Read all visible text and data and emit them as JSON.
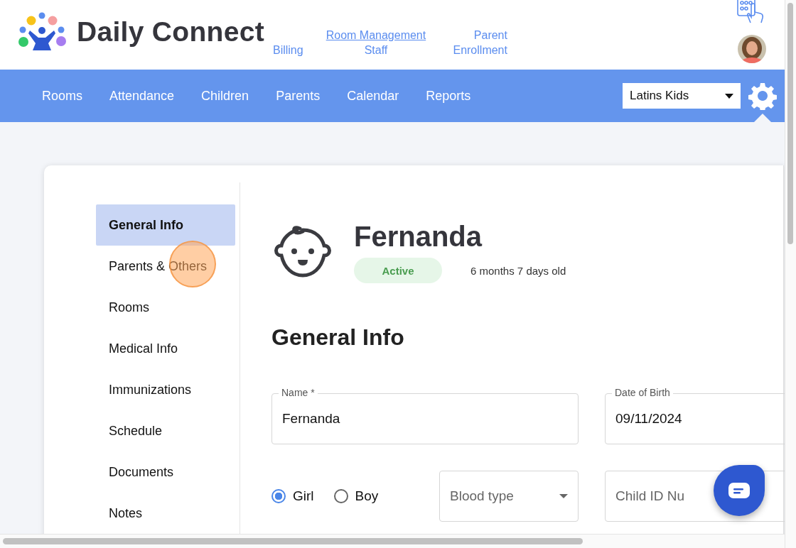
{
  "brand": {
    "name": "Daily Connect"
  },
  "header_links": [
    {
      "lines": [
        {
          "text": "Billing",
          "underlined": false
        }
      ]
    },
    {
      "lines": [
        {
          "text": "Room Management",
          "underlined": true
        },
        {
          "text": "Staff",
          "underlined": false
        }
      ]
    },
    {
      "lines": [
        {
          "text": "Parent",
          "underlined": false
        },
        {
          "text": "Enrollment",
          "underlined": false
        }
      ]
    }
  ],
  "nav": {
    "items": [
      "Rooms",
      "Attendance",
      "Children",
      "Parents",
      "Calendar",
      "Reports"
    ],
    "school_select": {
      "value": "Latins Kids"
    }
  },
  "sidebar": {
    "items": [
      {
        "label": "General Info",
        "selected": true
      },
      {
        "label": "Parents & Others",
        "selected": false
      },
      {
        "label": "Rooms",
        "selected": false
      },
      {
        "label": "Medical Info",
        "selected": false
      },
      {
        "label": "Immunizations",
        "selected": false
      },
      {
        "label": "Schedule",
        "selected": false
      },
      {
        "label": "Documents",
        "selected": false
      },
      {
        "label": "Notes",
        "selected": false
      }
    ]
  },
  "child": {
    "name": "Fernanda",
    "status": "Active",
    "age": "6 months 7 days old"
  },
  "section_title": "General Info",
  "fields": {
    "name": {
      "label": "Name *",
      "value": "Fernanda"
    },
    "date_of_birth": {
      "label": "Date of Birth",
      "value": "09/11/2024"
    },
    "gender": [
      {
        "label": "Girl",
        "selected": true
      },
      {
        "label": "Boy",
        "selected": false
      }
    ],
    "blood_type": {
      "placeholder": "Blood type"
    },
    "child_id": {
      "placeholder": "Child ID Nu"
    }
  }
}
